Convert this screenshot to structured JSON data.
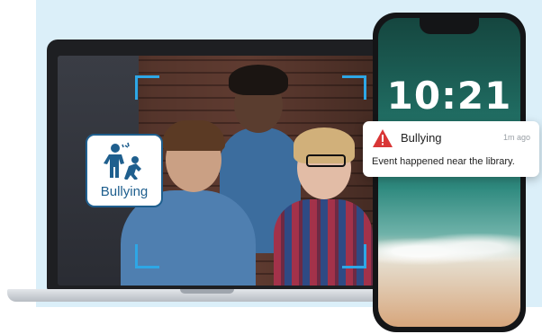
{
  "detection": {
    "label": "Bullying",
    "icon": "bullying-icon",
    "frame_color": "#2ea7e6"
  },
  "phone": {
    "time": "10:21"
  },
  "notification": {
    "icon": "warning-icon",
    "title": "Bullying",
    "age": "1m ago",
    "message": "Event happened near the library."
  },
  "colors": {
    "backdrop": "#dbeff9",
    "badge_accent": "#1f5f8e",
    "warning": "#d93636"
  }
}
